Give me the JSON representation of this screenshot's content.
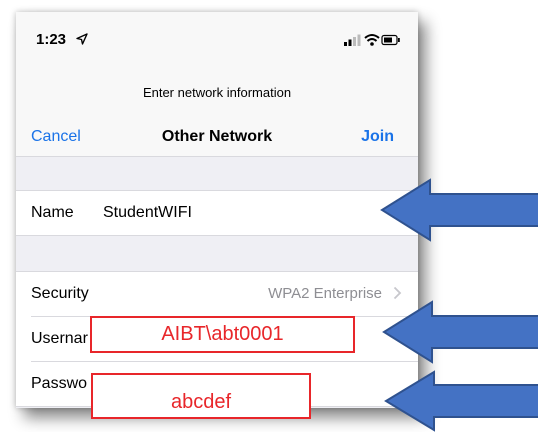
{
  "status_bar": {
    "time": "1:23"
  },
  "nav": {
    "prompt": "Enter network information",
    "cancel_label": "Cancel",
    "title": "Other Network",
    "join_label": "Join"
  },
  "name_row": {
    "label": "Name",
    "value": "StudentWIFI"
  },
  "security_row": {
    "label": "Security",
    "value": "WPA2 Enterprise"
  },
  "username_row": {
    "label": "Usernar"
  },
  "password_row": {
    "label": "Passwo"
  },
  "overlays": {
    "username_value": "AIBT\\abt0001",
    "password_value": "abcdef"
  },
  "colors": {
    "accent": "#1a73e8",
    "annotation_red": "#e8262a",
    "arrow_blue": "#4472c4"
  }
}
